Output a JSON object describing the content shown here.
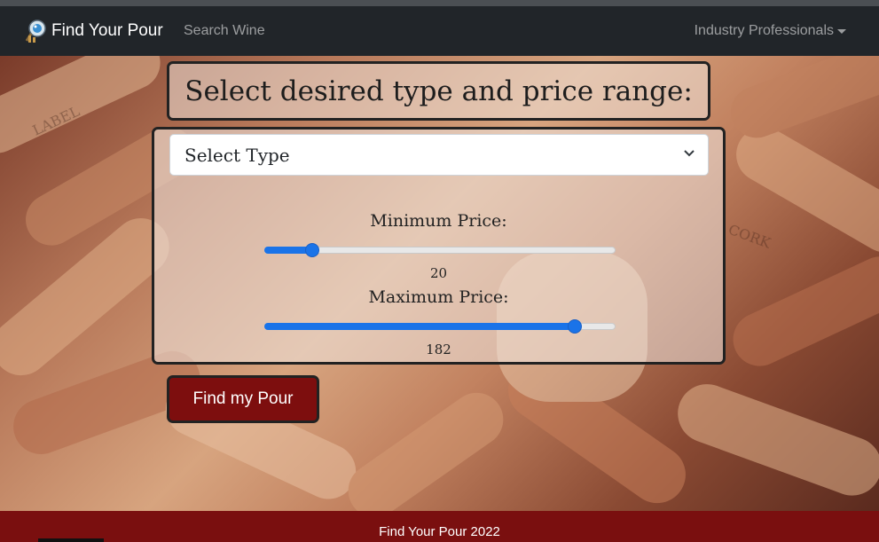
{
  "nav": {
    "brand": "Find Your Pour",
    "search_link": "Search Wine",
    "industry_link": "Industry Professionals",
    "brand_icon": "wine-logo-icon"
  },
  "form": {
    "heading": "Select desired type and price range:",
    "type_select": {
      "selected": "Select Type",
      "icon": "chevron-down-icon"
    },
    "min_price": {
      "label": "Minimum Price:",
      "value": "20",
      "level": 0.12
    },
    "max_price": {
      "label": "Maximum Price:",
      "value": "182",
      "level": 0.9
    },
    "submit": "Find my Pour"
  },
  "footer": {
    "text": "Find Your Pour 2022"
  },
  "colors": {
    "navbar": "#212529",
    "button": "#7d0e0e",
    "footer": "#7a0f0f",
    "slider_accent": "#1a73e8"
  }
}
